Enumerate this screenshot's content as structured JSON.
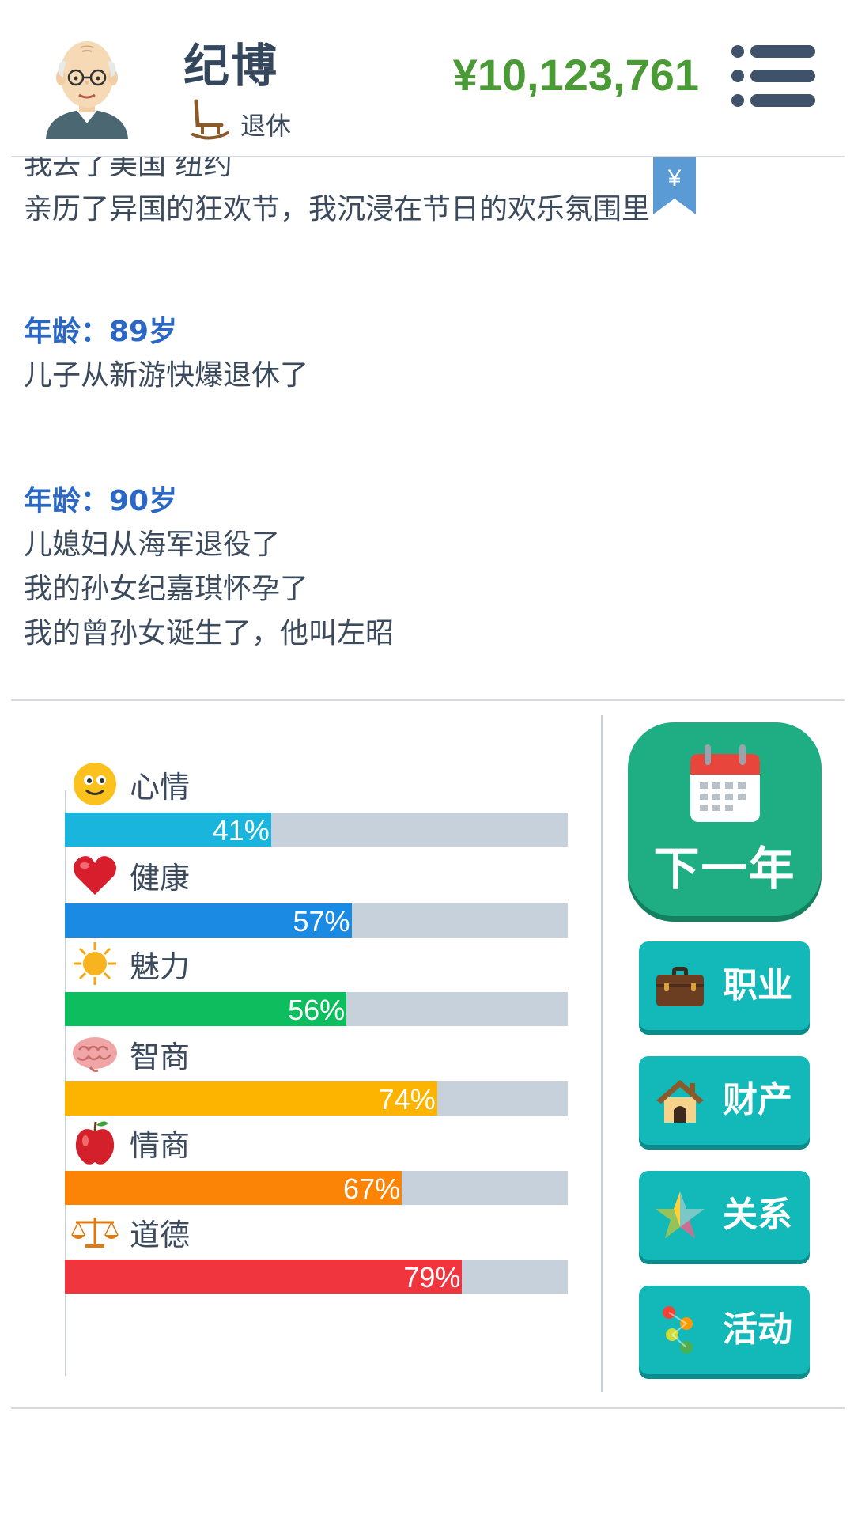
{
  "header": {
    "name": "纪博",
    "status": "退休",
    "money": "¥10,123,761",
    "money_color": "#4a9a36"
  },
  "log": {
    "partial_line": "我去了美国 纽约",
    "line_carnival": "亲历了异国的狂欢节，我沉浸在节日的欢乐氛围里",
    "entries": [
      {
        "age": "年龄：89岁",
        "lines": [
          "儿子从新游快爆退休了"
        ]
      },
      {
        "age": "年龄：90岁",
        "lines": [
          "儿媳妇从海军退役了",
          "我的孙女纪嘉琪怀孕了",
          "我的曾孙女诞生了，他叫左昭"
        ]
      }
    ],
    "bookmark_symbol": "¥"
  },
  "stats": [
    {
      "name": "心情",
      "value": "41%",
      "fraction": 0.41,
      "color": "#19b5dc",
      "icon": "smiley-icon"
    },
    {
      "name": "健康",
      "value": "57%",
      "fraction": 0.57,
      "color": "#1a8ae3",
      "icon": "heart-icon"
    },
    {
      "name": "魅力",
      "value": "56%",
      "fraction": 0.56,
      "color": "#0dbd5e",
      "icon": "sun-icon"
    },
    {
      "name": "智商",
      "value": "74%",
      "fraction": 0.74,
      "color": "#fcb400",
      "icon": "brain-icon"
    },
    {
      "name": "情商",
      "value": "67%",
      "fraction": 0.67,
      "color": "#fb8406",
      "icon": "apple-icon"
    },
    {
      "name": "道德",
      "value": "79%",
      "fraction": 0.79,
      "color": "#f1353f",
      "icon": "scales-icon"
    }
  ],
  "actions": {
    "next_year": "下一年",
    "career": "职业",
    "assets": "财产",
    "relations": "关系",
    "activities": "活动"
  }
}
